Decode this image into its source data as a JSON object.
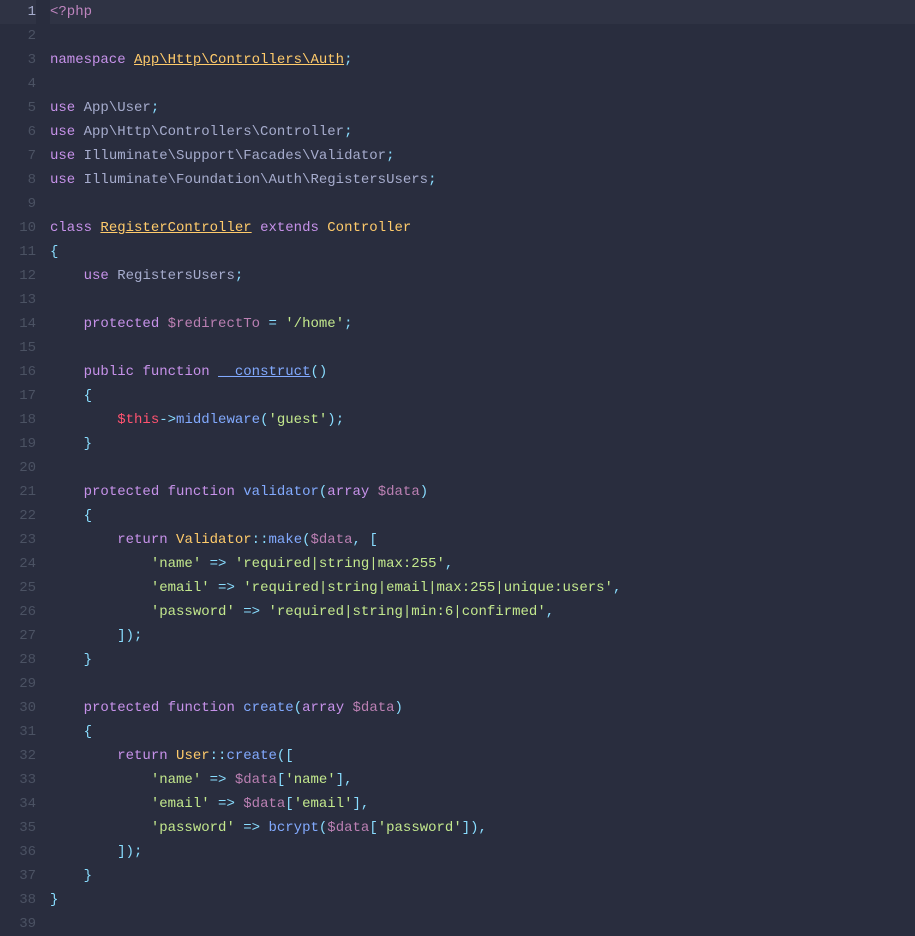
{
  "lines": {
    "l1": "1",
    "l2": "2",
    "l3": "3",
    "l4": "4",
    "l5": "5",
    "l6": "6",
    "l7": "7",
    "l8": "8",
    "l9": "9",
    "l10": "10",
    "l11": "11",
    "l12": "12",
    "l13": "13",
    "l14": "14",
    "l15": "15",
    "l16": "16",
    "l17": "17",
    "l18": "18",
    "l19": "19",
    "l20": "20",
    "l21": "21",
    "l22": "22",
    "l23": "23",
    "l24": "24",
    "l25": "25",
    "l26": "26",
    "l27": "27",
    "l28": "28",
    "l29": "29",
    "l30": "30",
    "l31": "31",
    "l32": "32",
    "l33": "33",
    "l34": "34",
    "l35": "35",
    "l36": "36",
    "l37": "37",
    "l38": "38",
    "l39": "39"
  },
  "t": {
    "phpopen": "<?php",
    "namespace": "namespace",
    "use": "use",
    "class": "class",
    "extends": "extends",
    "public": "public",
    "protected": "protected",
    "function": "function",
    "return": "return",
    "array": "array",
    "ns_full": "App\\Http\\Controllers\\Auth",
    "ns_user": "App\\User",
    "ns_controller": "App\\Http\\Controllers\\Controller",
    "ns_validator": "Illuminate\\Support\\Facades\\Validator",
    "ns_registers": "Illuminate\\Foundation\\Auth\\RegistersUsers",
    "RegisterController": "RegisterController",
    "Controller": "Controller",
    "RegistersUsers": "RegistersUsers",
    "redirectTo": "$redirectTo",
    "home": "'/home'",
    "construct": "__construct",
    "this": "$this",
    "middleware": "middleware",
    "guest": "'guest'",
    "validator": "validator",
    "data": "$data",
    "Validator": "Validator",
    "make": "make",
    "name_k": "'name'",
    "name_v": "'required|string|max:255'",
    "email_k": "'email'",
    "email_v": "'required|string|email|max:255|unique:users'",
    "password_k": "'password'",
    "password_v": "'required|string|min:6|confirmed'",
    "create": "create",
    "User": "User",
    "bcrypt": "bcrypt",
    "semi": ";",
    "obrace": "{",
    "cbrace": "}",
    "oparen": "(",
    "cparen": ")",
    "obrack": "[",
    "cbrack": "]",
    "comma": ",",
    "eq": "=",
    "arrow": "->",
    "fat": "=>",
    "scope": "::",
    "sp1": " ",
    "ind1": "    ",
    "ind2": "        ",
    "ind3": "            ",
    "ind4": "                "
  }
}
